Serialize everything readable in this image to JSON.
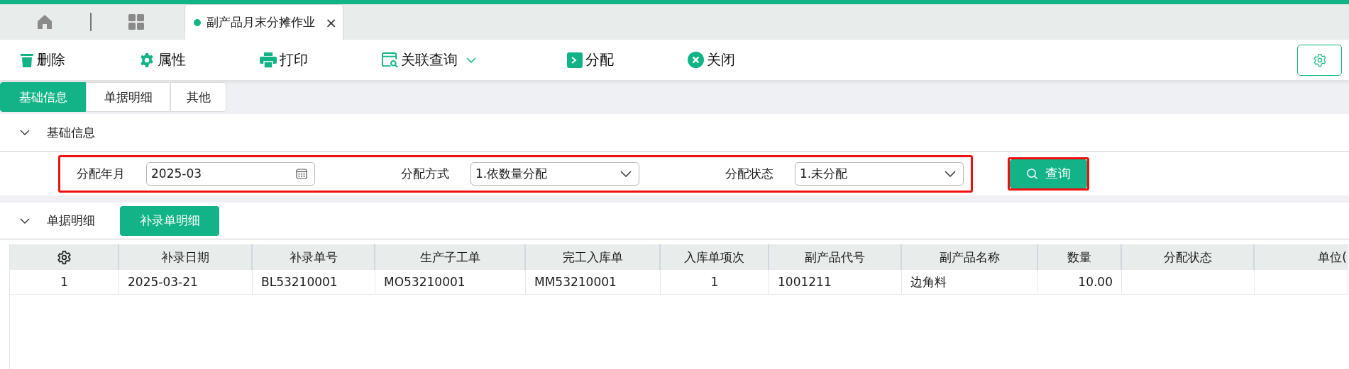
{
  "doc_tabs": [
    {
      "label": "副产品月末分摊作业",
      "selected": true,
      "close": "×"
    }
  ],
  "toolbar": [
    {
      "kind": "delete",
      "label": "删除",
      "dropdown": false
    },
    {
      "kind": "properties",
      "label": "属性",
      "dropdown": false
    },
    {
      "kind": "print",
      "label": "打印",
      "dropdown": false
    },
    {
      "kind": "linked-query",
      "label": "关联查询",
      "dropdown": true
    },
    {
      "kind": "allocate",
      "label": "分配",
      "dropdown": false
    },
    {
      "kind": "close",
      "label": "关闭",
      "dropdown": false
    }
  ],
  "sub_tabs": [
    {
      "label": "基础信息",
      "selected": true
    },
    {
      "label": "单据明细",
      "selected": false
    },
    {
      "label": "其他",
      "selected": false
    }
  ],
  "basic_section": {
    "title": "基础信息",
    "expanded": true,
    "filters": [
      {
        "kind": "date",
        "label": "分配年月",
        "value": "2025-03"
      },
      {
        "kind": "select",
        "label": "分配方式",
        "value": "1.依数量分配"
      },
      {
        "kind": "select",
        "label": "分配状态",
        "value": "1.未分配"
      }
    ],
    "highlighted": true,
    "query_button": {
      "label": "查询",
      "highlighted": true
    }
  },
  "detail_section": {
    "title": "单据明细",
    "expanded": true,
    "button": "补录单明细",
    "table": {
      "columns": [
        "补录日期",
        "补录单号",
        "生产子工单",
        "完工入库单",
        "入库单项次",
        "副产品代号",
        "副产品名称",
        "数量",
        "分配状态",
        "单位("
      ],
      "rows": [
        {
          "index": "1",
          "cells": [
            "2025-03-21",
            "BL53210001",
            "MO53210001",
            "MM53210001",
            "1",
            "1001211",
            "边角料",
            "10.00",
            ""
          ]
        }
      ]
    }
  }
}
